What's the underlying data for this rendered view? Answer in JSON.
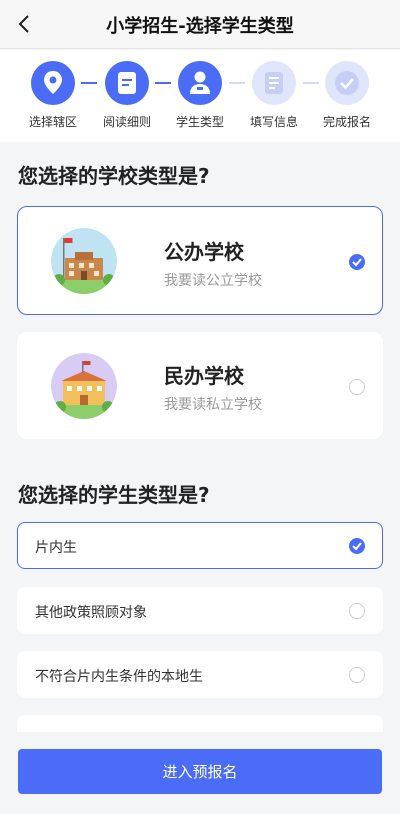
{
  "header": {
    "title": "小学招生-选择学生类型"
  },
  "steps": [
    {
      "label": "选择辖区",
      "state": "done",
      "icon": "location-icon"
    },
    {
      "label": "阅读细则",
      "state": "done",
      "icon": "document-icon"
    },
    {
      "label": "学生类型",
      "state": "current",
      "icon": "student-icon"
    },
    {
      "label": "填写信息",
      "state": "todo",
      "icon": "form-icon"
    },
    {
      "label": "完成报名",
      "state": "todo",
      "icon": "check-icon"
    }
  ],
  "school_section": {
    "title": "您选择的学校类型是?",
    "options": [
      {
        "name": "公办学校",
        "desc": "我要读公立学校",
        "selected": true
      },
      {
        "name": "民办学校",
        "desc": "我要读私立学校",
        "selected": false
      }
    ]
  },
  "student_section": {
    "title": "您选择的学生类型是?",
    "options": [
      {
        "label": "片内生",
        "selected": true
      },
      {
        "label": "其他政策照顾对象",
        "selected": false
      },
      {
        "label": "不符合片内生条件的本地生",
        "selected": false
      }
    ]
  },
  "submit": {
    "label": "进入预报名"
  },
  "colors": {
    "accent": "#4a6cf7",
    "accent_light": "#dfe5fb",
    "page_bg": "#f4f5f7"
  }
}
